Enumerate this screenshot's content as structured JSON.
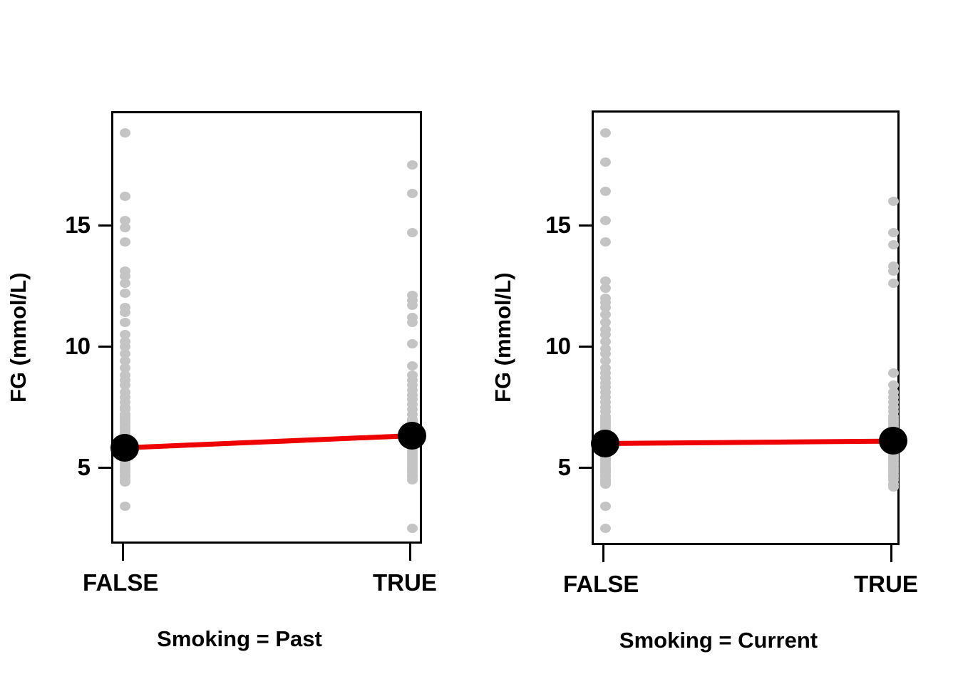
{
  "figure": {
    "ylabel": "FG (mmol/L)",
    "accent_color": "#ee0000",
    "point_color": "#c4c4c4",
    "mean_color": "#000000"
  },
  "panels": [
    {
      "id": "left",
      "xlabel": "Smoking = Past",
      "categories": [
        "FALSE",
        "TRUE"
      ],
      "y_ticks": [
        "5",
        "10",
        "15"
      ]
    },
    {
      "id": "right",
      "xlabel": "Smoking = Current",
      "categories": [
        "FALSE",
        "TRUE"
      ],
      "y_ticks": [
        "5",
        "10",
        "15"
      ]
    }
  ],
  "chart_data": {
    "type": "scatter",
    "title": "",
    "ylabel": "FG (mmol/L)",
    "xlabel": "",
    "ylim": [
      2.2,
      19.2
    ],
    "ytick_values": [
      5,
      10,
      15
    ],
    "grid": false,
    "legend": null,
    "panels": [
      {
        "name": "Smoking = Past",
        "xlabel": "Smoking = Past",
        "xcategories": [
          "FALSE",
          "TRUE"
        ],
        "series": [
          {
            "name": "FALSE raw FG values",
            "category": "FALSE",
            "values": [
              18.9,
              16.3,
              15.3,
              15.0,
              14.4,
              13.2,
              13.0,
              12.7,
              12.3,
              11.7,
              11.5,
              11.1,
              10.6,
              10.3,
              10.1,
              9.8,
              9.5,
              9.2,
              8.9,
              8.7,
              8.5,
              8.2,
              8.0,
              7.8,
              7.6,
              7.5,
              7.3,
              7.2,
              7.1,
              7.0,
              6.9,
              6.8,
              6.7,
              6.6,
              6.5,
              6.4,
              6.3,
              6.2,
              6.1,
              6.0,
              5.9,
              5.8,
              5.7,
              5.6,
              5.5,
              5.4,
              5.3,
              5.2,
              5.1,
              5.0,
              4.9,
              4.8,
              4.7,
              4.6,
              4.5,
              3.5
            ]
          },
          {
            "name": "TRUE raw FG values",
            "category": "TRUE",
            "values": [
              17.6,
              16.4,
              14.8,
              12.2,
              12.0,
              11.8,
              11.3,
              11.1,
              10.2,
              9.3,
              8.9,
              8.7,
              8.5,
              8.3,
              8.1,
              7.9,
              7.7,
              7.5,
              7.3,
              7.1,
              7.0,
              6.9,
              6.8,
              6.7,
              6.6,
              6.5,
              6.4,
              6.3,
              6.2,
              6.1,
              6.0,
              5.9,
              5.8,
              5.7,
              5.6,
              5.5,
              5.4,
              5.3,
              5.2,
              5.1,
              5.0,
              4.9,
              4.8,
              4.7,
              4.6,
              2.6
            ]
          }
        ],
        "means": {
          "FALSE": 5.9,
          "TRUE": 6.4
        }
      },
      {
        "name": "Smoking = Current",
        "xlabel": "Smoking = Current",
        "xcategories": [
          "FALSE",
          "TRUE"
        ],
        "series": [
          {
            "name": "FALSE raw FG values",
            "category": "FALSE",
            "values": [
              18.9,
              17.7,
              16.5,
              15.3,
              14.4,
              12.8,
              12.5,
              12.1,
              11.9,
              11.7,
              11.4,
              11.1,
              10.8,
              10.6,
              10.3,
              10.0,
              9.8,
              9.5,
              9.2,
              9.0,
              8.8,
              8.6,
              8.4,
              8.2,
              8.0,
              7.8,
              7.6,
              7.4,
              7.2,
              7.1,
              7.0,
              6.9,
              6.8,
              6.7,
              6.6,
              6.5,
              6.4,
              6.3,
              6.2,
              6.1,
              6.0,
              5.9,
              5.8,
              5.7,
              5.6,
              5.5,
              5.4,
              5.3,
              5.2,
              5.1,
              5.0,
              4.9,
              4.8,
              4.7,
              4.6,
              4.5,
              4.4,
              3.5,
              2.6
            ]
          },
          {
            "name": "TRUE raw FG values",
            "category": "TRUE",
            "values": [
              16.1,
              14.8,
              14.3,
              13.4,
              13.2,
              12.7,
              9.0,
              8.5,
              8.2,
              8.0,
              7.8,
              7.6,
              7.4,
              7.2,
              7.1,
              7.0,
              6.9,
              6.8,
              6.7,
              6.6,
              6.5,
              6.4,
              6.3,
              6.2,
              6.1,
              6.0,
              5.9,
              5.8,
              5.7,
              5.6,
              5.5,
              5.4,
              5.3,
              5.2,
              5.1,
              5.0,
              4.9,
              4.8,
              4.7,
              4.6,
              4.4,
              4.3
            ]
          }
        ],
        "means": {
          "FALSE": 6.1,
          "TRUE": 6.2
        }
      }
    ]
  }
}
